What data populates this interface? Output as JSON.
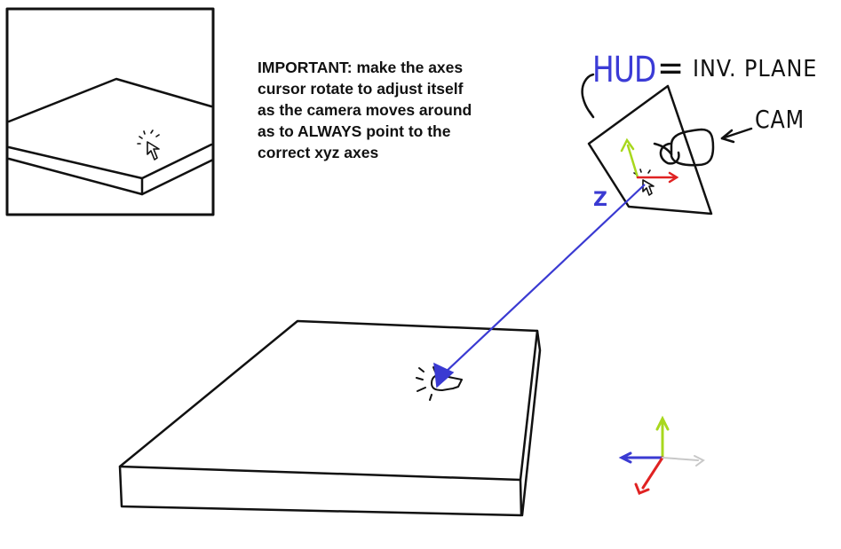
{
  "note": {
    "lines": [
      "IMPORTANT: make the axes",
      "cursor rotate to adjust itself",
      "as the camera moves around",
      "as to ALWAYS point to the",
      "correct xyz axes"
    ]
  },
  "labels": {
    "hud": "HUD",
    "equals": "=",
    "inv_plane": "INV. PLANE",
    "cam": "CAM",
    "z_axis": "Z"
  },
  "colors": {
    "ink": "#111111",
    "hud_text": "#3b3bd6",
    "z_axis": "#3a3ad2",
    "y_axis": "#a8d81e",
    "x_axis": "#e02222",
    "neg_x_axis": "#c8c8c8"
  },
  "icons": {
    "cursor": "pointer-cursor-icon",
    "cam": "camera-icon"
  }
}
